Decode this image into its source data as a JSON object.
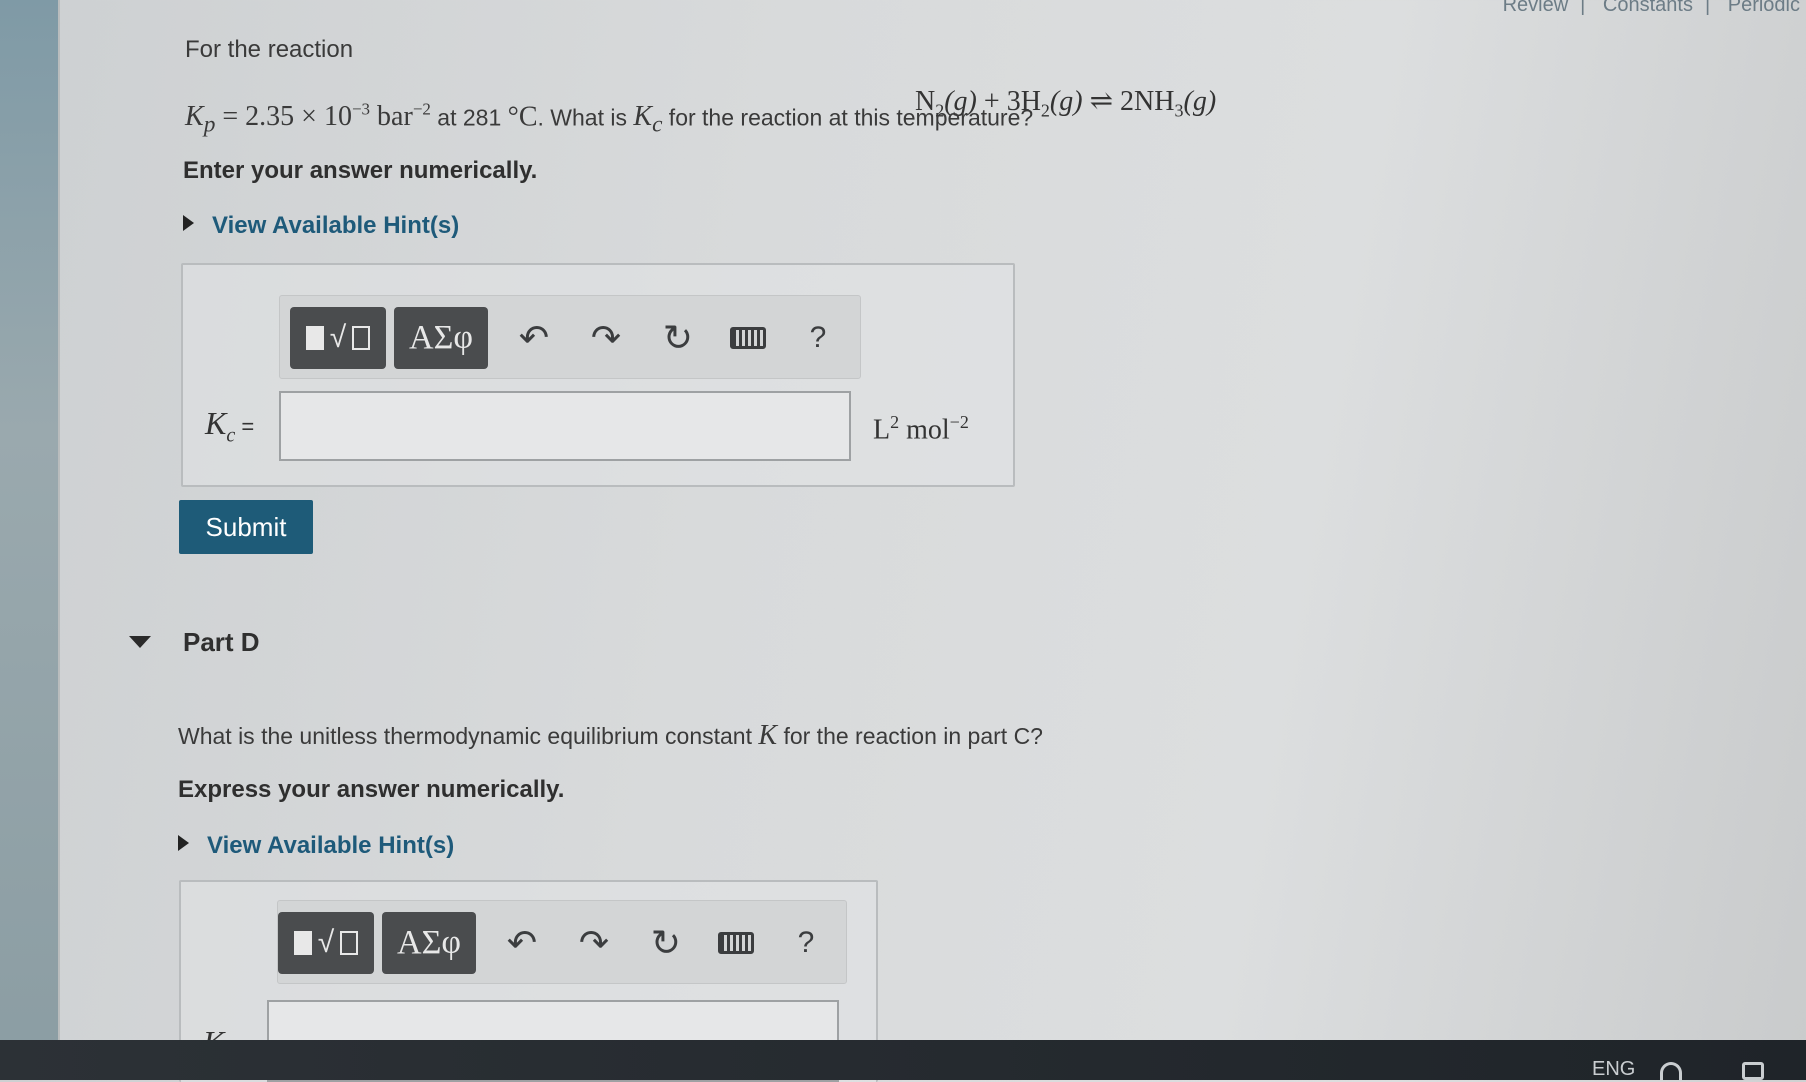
{
  "header_links": [
    "Review",
    "Constants",
    "Periodic"
  ],
  "part_c": {
    "intro": "For the reaction",
    "equation": {
      "n2": "N",
      "n2_sub": "2",
      "n2_state": "(g)",
      "plus": " + ",
      "h2_coeff": "3H",
      "h2_sub": "2",
      "h2_state": "(g)",
      "arrow": " ⇌ ",
      "nh3_coeff": "2NH",
      "nh3_sub": "3",
      "nh3_state": "(g)"
    },
    "kp_symbol": "K",
    "kp_sub": "p",
    "kp_eq": " = 2.35 × 10",
    "kp_exp": "−3",
    "kp_unit": " bar",
    "kp_unit_exp": "−2",
    "at_text": " at 281 ",
    "temp_unit": "°C",
    "what_is": ". What is ",
    "kc_symbol": "K",
    "kc_sub": "c",
    "question_tail": " for the reaction at this temperature?",
    "instruction": "Enter your answer numerically.",
    "hint_label": "View Available Hint(s)",
    "answer_label_symbol": "K",
    "answer_label_sub": "c",
    "answer_label_eq": " =",
    "answer_value": "",
    "unit_L": "L",
    "unit_L_exp": "2",
    "unit_mol": " mol",
    "unit_mol_exp": "−2",
    "submit_label": "Submit"
  },
  "part_d": {
    "title": "Part D",
    "question_head": "What is the unitless thermodynamic equilibrium constant ",
    "question_symbol": "K",
    "question_tail": " for the reaction in part C?",
    "instruction": "Express your answer numerically.",
    "hint_label": "View Available Hint(s)",
    "answer_label_symbol": "K",
    "answer_label_eq": " =",
    "answer_value": ""
  },
  "toolbar": {
    "templates_icon": "fraction-sqrt-templates-icon",
    "greek_label": "ΑΣφ",
    "undo_glyph": "↶",
    "redo_glyph": "↷",
    "reset_glyph": "↻",
    "keyboard_icon": "keyboard-icon",
    "help_label": "?"
  },
  "taskbar": {
    "language": "ENG"
  },
  "colors": {
    "accent": "#1e5b78",
    "toolbar_button": "#4a4c4e",
    "hint_text": "#1e5a7a"
  }
}
